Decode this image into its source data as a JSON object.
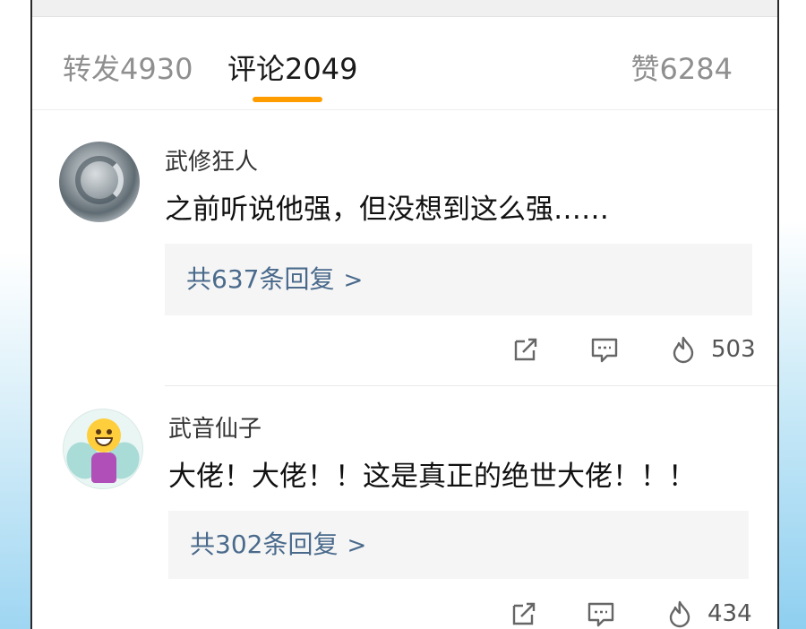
{
  "tabs": {
    "repost": "转发4930",
    "comment": "评论2049",
    "like": "赞6284"
  },
  "accent_color": "#ff9d00",
  "comments": [
    {
      "username": "武修狂人",
      "text": "之前听说他强，但没想到这么强……",
      "replies_label": "共637条回复",
      "likes": "503",
      "avatar_icon": "silver-dragon-avatar"
    },
    {
      "username": "武音仙子",
      "text": "大佬！大佬！！这是真正的绝世大佬！！！",
      "replies_label": "共302条回复",
      "likes": "434",
      "avatar_icon": "smiling-fairy-avatar"
    }
  ]
}
